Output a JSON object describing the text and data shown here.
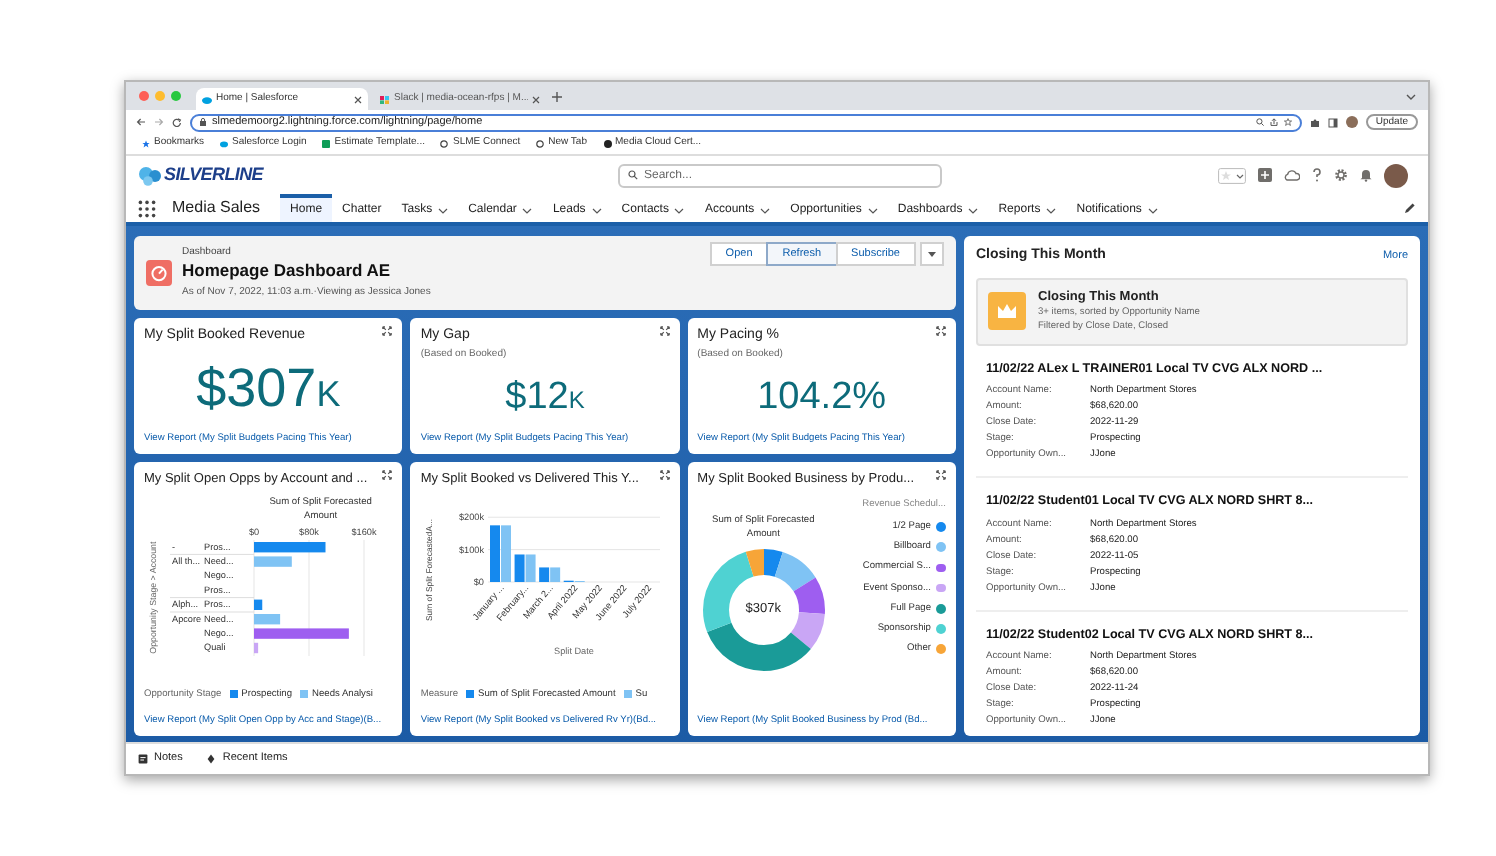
{
  "browser": {
    "tabs": [
      {
        "label": "Home | Salesforce",
        "selected": true
      },
      {
        "label": "Slack | media-ocean-rfps | M...",
        "selected": false
      }
    ],
    "url": "slmedemoorg2.lightning.force.com/lightning/page/home",
    "update_button": "Update",
    "bookmarks": [
      "Bookmarks",
      "Salesforce Login",
      "Estimate Template...",
      "SLME Connect",
      "New Tab",
      "Media Cloud Cert..."
    ]
  },
  "app": {
    "logo": "SILVERLINE",
    "search_placeholder": "Search...",
    "app_name": "Media Sales",
    "nav": [
      {
        "label": "Home",
        "selected": true,
        "menu": false
      },
      {
        "label": "Chatter",
        "selected": false,
        "menu": false
      },
      {
        "label": "Tasks",
        "selected": false,
        "menu": true
      },
      {
        "label": "Calendar",
        "selected": false,
        "menu": true
      },
      {
        "label": "Leads",
        "selected": false,
        "menu": true
      },
      {
        "label": "Contacts",
        "selected": false,
        "menu": true
      },
      {
        "label": "Accounts",
        "selected": false,
        "menu": true
      },
      {
        "label": "Opportunities",
        "selected": false,
        "menu": true
      },
      {
        "label": "Dashboards",
        "selected": false,
        "menu": true
      },
      {
        "label": "Reports",
        "selected": false,
        "menu": true
      },
      {
        "label": "Notifications",
        "selected": false,
        "menu": true
      }
    ]
  },
  "dashboard": {
    "type_label": "Dashboard",
    "title": "Homepage Dashboard AE",
    "subtitle": "As of Nov 7, 2022, 11:03 a.m.·Viewing as Jessica Jones",
    "buttons": [
      {
        "label": "Open",
        "selected": false
      },
      {
        "label": "Refresh",
        "selected": true
      },
      {
        "label": "Subscribe",
        "selected": false
      }
    ],
    "metrics": [
      {
        "title": "My Split Booked Revenue",
        "value": "$307",
        "unit": "K",
        "link": "View Report (My Split Budgets Pacing This Year)"
      },
      {
        "title": "My Gap",
        "subtitle": "(Based on Booked)",
        "value": "$12",
        "unit": "K",
        "link": "View Report (My Split Budgets Pacing This Year)"
      },
      {
        "title": "My Pacing %",
        "subtitle": "(Based on Booked)",
        "value": "104.2%",
        "link": "View Report (My Split Budgets Pacing This Year)"
      }
    ],
    "opps_chart": {
      "title": "My Split Open Opps by Account and ...",
      "legend_title": "Opportunity Stage",
      "link": "View Report (My Split Open Opp by Acc and Stage)(B...",
      "account_labels": [
        {
          "label": "-"
        },
        {
          "label": "All th..."
        },
        {
          "label": "Alph..."
        },
        {
          "label": "Apcore"
        }
      ],
      "chart_data": {
        "type": "bar",
        "orientation": "horizontal",
        "stacked": true,
        "title": "Sum of Split Forecasted Amount",
        "ylabel": "Opportunity Stage > Account",
        "categories": [
          "Pros...",
          "Need...",
          "Nego...",
          "Pros...",
          "Pros...",
          "Need...",
          "Nego...",
          "Quali"
        ],
        "xlim": [
          0,
          160000
        ],
        "xticks": [
          {
            "value": 0,
            "label": "$0"
          },
          {
            "value": 80000,
            "label": "$80k"
          },
          {
            "value": 160000,
            "label": "$160k"
          }
        ],
        "series": [
          {
            "name": "Prospecting",
            "color": "#1589ee",
            "values": [
              104000,
              null,
              null,
              null,
              12000,
              null,
              null,
              null
            ]
          },
          {
            "name": "Needs Analysi",
            "color": "#7fc3f4",
            "values": [
              null,
              55000,
              null,
              null,
              null,
              38000,
              null,
              null
            ]
          },
          {
            "color": "#9e5ef0",
            "values": [
              null,
              null,
              null,
              null,
              null,
              null,
              138000,
              null
            ]
          },
          {
            "color": "#c9a6f5",
            "values": [
              null,
              null,
              null,
              null,
              null,
              null,
              null,
              6000
            ]
          }
        ]
      }
    },
    "booked_chart": {
      "title": "My Split Booked vs Delivered This Y...",
      "legend_title": "Measure",
      "link": "View Report (My Split Booked vs Delivered Rv Yr)(Bd...",
      "chart_data": {
        "type": "bar",
        "orientation": "vertical",
        "xlabel": "Split Date",
        "ylabel": "Sum of Split ForecastedA...",
        "categories": [
          "January ...",
          "February...",
          "March 2...",
          "April 2022",
          "May 2022",
          "June 2022",
          "July 2022"
        ],
        "ylim": [
          0,
          210000
        ],
        "yticks": [
          {
            "value": 0,
            "label": "$0"
          },
          {
            "value": 100000,
            "label": "$100k"
          },
          {
            "value": 200000,
            "label": "$200k"
          }
        ],
        "series": [
          {
            "name": "Sum of Split Forecasted Amount",
            "color": "#1589ee",
            "values": [
              175000,
              85000,
              45000,
              4000,
              0,
              0,
              0
            ]
          },
          {
            "name": "Su",
            "color": "#7fc3f4",
            "values": [
              175000,
              85000,
              45000,
              3000,
              0,
              0,
              0
            ]
          }
        ]
      }
    },
    "product_chart": {
      "title": "My Split Booked Business by Produ...",
      "measure": "Sum of Split Forecasted Amount",
      "total": "$307k",
      "legend_title": "Revenue Schedul...",
      "link": "View Report (My Split Booked Business by Prod (Bd...",
      "legend": [
        {
          "label": "1/2 Page",
          "color": "#1589ee"
        },
        {
          "label": "Billboard",
          "color": "#7fc3f4"
        },
        {
          "label": "Commercial S...",
          "color": "#9e5ef0"
        },
        {
          "label": "Event Sponso...",
          "color": "#c9a6f5"
        },
        {
          "label": "Full Page",
          "color": "#1a9b98"
        },
        {
          "label": "Sponsorship",
          "color": "#4fd2d2"
        },
        {
          "label": "Other",
          "color": "#f7a538"
        }
      ]
    }
  },
  "closing": {
    "title": "Closing This Month",
    "more": "More",
    "list_title": "Closing This Month",
    "list_info": "3+ items, sorted by Opportunity Name",
    "list_filter": "Filtered by Close Date, Closed",
    "records": [
      {
        "title": "11/02/22 ALex L TRAINER01 Local TV CVG ALX NORD ...",
        "fields": [
          {
            "label": "Account Name:",
            "value": "North Department Stores"
          },
          {
            "label": "Amount:",
            "value": "$68,620.00"
          },
          {
            "label": "Close Date:",
            "value": "2022-11-29"
          },
          {
            "label": "Stage:",
            "value": "Prospecting"
          },
          {
            "label": "Opportunity Own...",
            "value": "JJone"
          }
        ]
      },
      {
        "title": "11/02/22 Student01 Local TV CVG ALX NORD SHRT 8...",
        "fields": [
          {
            "label": "Account Name:",
            "value": "North Department Stores"
          },
          {
            "label": "Amount:",
            "value": "$68,620.00"
          },
          {
            "label": "Close Date:",
            "value": "2022-11-05"
          },
          {
            "label": "Stage:",
            "value": "Prospecting"
          },
          {
            "label": "Opportunity Own...",
            "value": "JJone"
          }
        ]
      },
      {
        "title": "11/02/22 Student02 Local TV CVG ALX NORD SHRT 8...",
        "fields": [
          {
            "label": "Account Name:",
            "value": "North Department Stores"
          },
          {
            "label": "Amount:",
            "value": "$68,620.00"
          },
          {
            "label": "Close Date:",
            "value": "2022-11-24"
          },
          {
            "label": "Stage:",
            "value": "Prospecting"
          },
          {
            "label": "Opportunity Own...",
            "value": "JJone"
          }
        ]
      }
    ]
  },
  "utility_bar": [
    "Notes",
    "Recent Items"
  ]
}
